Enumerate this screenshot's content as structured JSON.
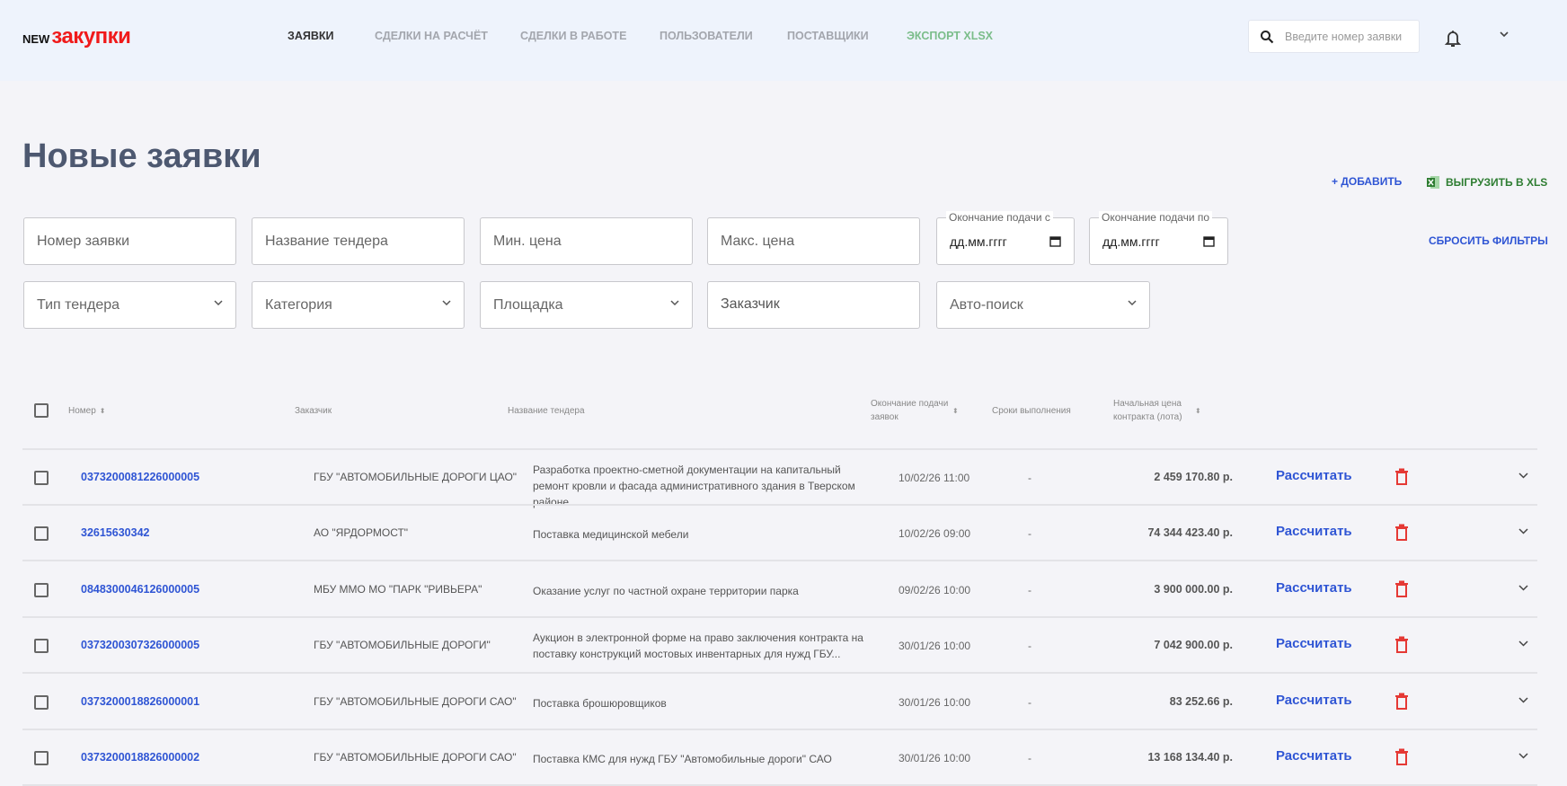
{
  "header": {
    "logo_prefix": "NEW",
    "logo_main": "закупки",
    "nav": [
      "ЗАЯВКИ",
      "СДЕЛКИ НА РАСЧЁТ",
      "СДЕЛКИ В РАБОТЕ",
      "ПОЛЬЗОВАТЕЛИ",
      "ПОСТАВЩИКИ",
      "ЭКСПОРТ XLSX"
    ],
    "search_placeholder": "Введите номер заявки"
  },
  "page": {
    "title": "Новые заявки",
    "add_label": "+ ДОБАВИТЬ",
    "export_label": "ВЫГРУЗИТЬ В XLS",
    "reset_label": "СБРОСИТЬ ФИЛЬТРЫ"
  },
  "filters": {
    "number": "Номер заявки",
    "tender_name": "Название тендера",
    "min_price": "Мин. цена",
    "max_price": "Макс. цена",
    "end_from_label": "Окончание подачи с",
    "end_to_label": "Окончание подачи по",
    "date_placeholder": "дд.мм.гггг",
    "tender_type": "Тип тендера",
    "category": "Категория",
    "platform": "Площадка",
    "customer": "Заказчик",
    "auto_search": "Авто-поиск"
  },
  "table": {
    "columns": {
      "number": "Номер",
      "customer": "Заказчик",
      "tender": "Название тендера",
      "end_l1": "Окончание подачи",
      "end_l2": "заявок",
      "terms": "Сроки выполнения",
      "price_l1": "Начальная цена",
      "price_l2": "контракта (лота)"
    },
    "calc_label": "Рассчитать",
    "rows": [
      {
        "number": "0373200081226000005",
        "customer": "ГБУ \"АВТОМОБИЛЬНЫЕ ДОРОГИ ЦАО\"",
        "tender": "Разработка проектно-сметной документации на капитальный ремонт кровли и фасада административного здания в Тверском районе...",
        "end": "10/02/26 11:00",
        "terms": "-",
        "price": "2 459 170.80 р."
      },
      {
        "number": "32615630342",
        "customer": "АО \"ЯРДОРМОСТ\"",
        "tender": "Поставка медицинской мебели",
        "end": "10/02/26 09:00",
        "terms": "-",
        "price": "74 344 423.40 р."
      },
      {
        "number": "0848300046126000005",
        "customer": "МБУ ММО МО \"ПАРК \"РИВЬЕРА\"",
        "tender": "Оказание услуг по частной охране территории парка",
        "end": "09/02/26 10:00",
        "terms": "-",
        "price": "3 900 000.00 р."
      },
      {
        "number": "0373200307326000005",
        "customer": "ГБУ \"АВТОМОБИЛЬНЫЕ ДОРОГИ\"",
        "tender": "Аукцион в электронной форме на право заключения контракта на поставку конструкций мостовых инвентарных для нужд ГБУ...",
        "end": "30/01/26 10:00",
        "terms": "-",
        "price": "7 042 900.00 р."
      },
      {
        "number": "0373200018826000001",
        "customer": "ГБУ \"АВТОМОБИЛЬНЫЕ ДОРОГИ САО\"",
        "tender": "Поставка брошюровщиков",
        "end": "30/01/26 10:00",
        "terms": "-",
        "price": "83 252.66 р."
      },
      {
        "number": "0373200018826000002",
        "customer": "ГБУ \"АВТОМОБИЛЬНЫЕ ДОРОГИ САО\"",
        "tender": "Поставка КМС для нужд ГБУ \"Автомобильные дороги\" САО",
        "end": "30/01/26 10:00",
        "terms": "-",
        "price": "13 168 134.40 р."
      }
    ]
  }
}
